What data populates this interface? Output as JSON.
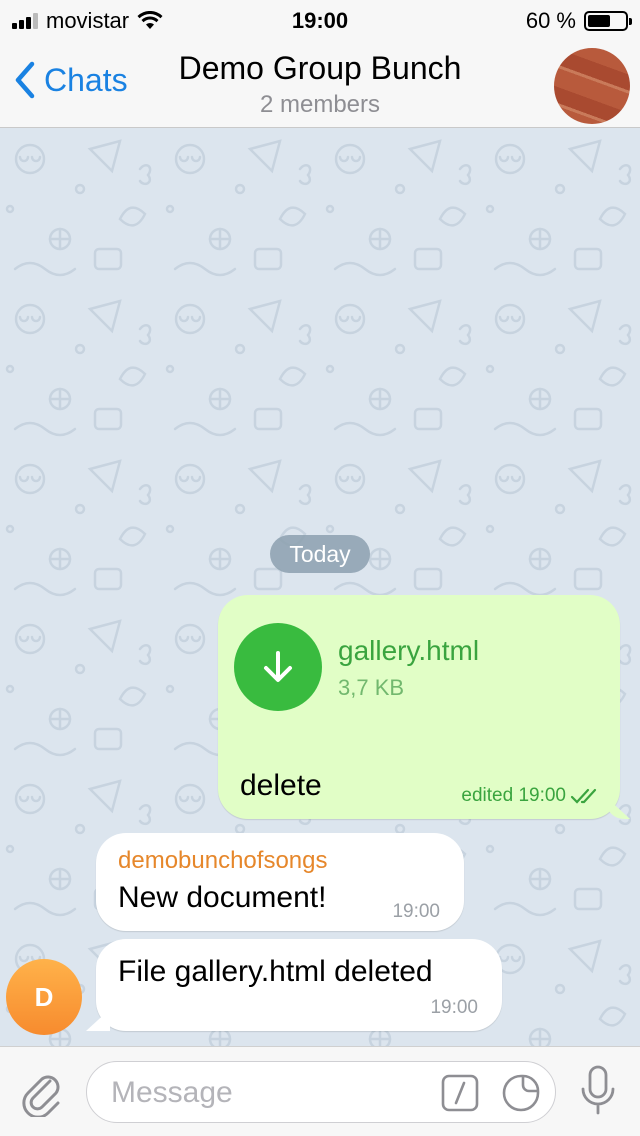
{
  "status_bar": {
    "carrier": "movistar",
    "time": "19:00",
    "battery": "60 %",
    "battery_level": 0.6
  },
  "nav": {
    "back_label": "Chats",
    "title": "Demo Group Bunch",
    "subtitle": "2 members"
  },
  "chat": {
    "date_separator": "Today",
    "outgoing": {
      "file_name": "gallery.html",
      "file_size": "3,7 KB",
      "text": "delete",
      "meta": "edited 19:00"
    },
    "incoming": [
      {
        "sender": "demobunchofsongs",
        "text": "New document!",
        "time": "19:00"
      },
      {
        "text": "File gallery.html deleted",
        "time": "19:00"
      }
    ],
    "avatar_initial": "D"
  },
  "input": {
    "placeholder": "Message"
  },
  "colors": {
    "accent": "#1a82e2",
    "outgoing_bubble": "#e1fec6",
    "download_button": "#39bb3f",
    "sender_name": "#e6872b",
    "background": "#dce5ee"
  }
}
